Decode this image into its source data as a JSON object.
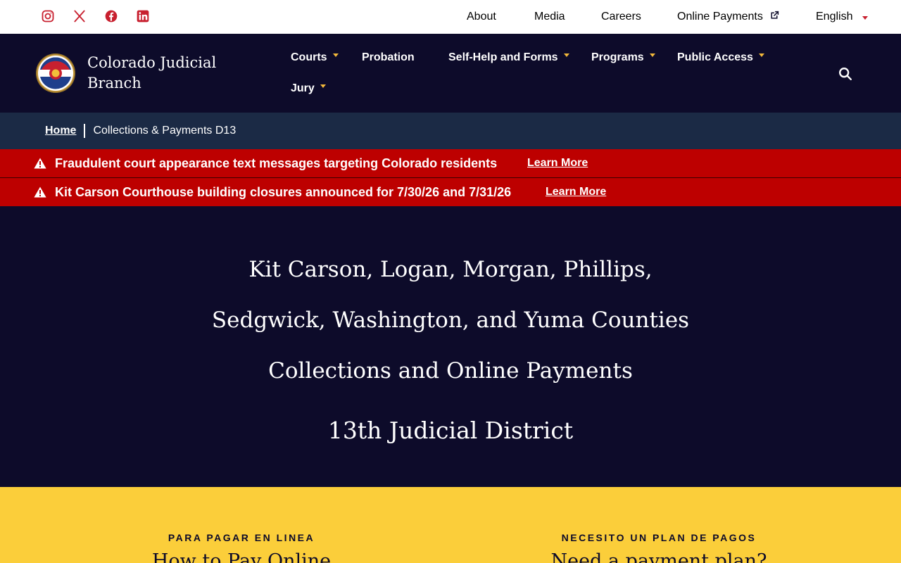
{
  "utility": {
    "social": [
      "instagram-icon",
      "x-icon",
      "facebook-icon",
      "linkedin-icon"
    ],
    "links": {
      "about": "About",
      "media": "Media",
      "careers": "Careers",
      "online_payments": "Online Payments",
      "language": "English"
    }
  },
  "header": {
    "brand": "Colorado Judicial Branch",
    "nav": {
      "courts": "Courts",
      "probation": "Probation",
      "self_help": "Self-Help and Forms",
      "programs": "Programs",
      "public_access": "Public Access",
      "jury": "Jury"
    }
  },
  "breadcrumb": {
    "home": "Home",
    "current": "Collections & Payments D13"
  },
  "alerts": [
    {
      "text": "Fraudulent court appearance text messages targeting Colorado residents",
      "link": "Learn More"
    },
    {
      "text": "Kit Carson Courthouse building closures announced for 7/30/26 and 7/31/26",
      "link": "Learn More"
    }
  ],
  "hero": {
    "line1": "Kit Carson, Logan, Morgan, Phillips,",
    "line2": "Sedgwick, Washington, and Yuma Counties",
    "line3": "Collections and Online Payments",
    "line4": "13th Judicial District"
  },
  "payments": {
    "col1": {
      "kicker": "PARA PAGAR EN LINEA",
      "title": "How to Pay Online"
    },
    "col2": {
      "kicker": "NECESITO UN PLAN DE PAGOS",
      "title": "Need a payment plan?"
    }
  },
  "colors": {
    "navy": "#0d0b2a",
    "breadcrumb_bg": "#1b2a45",
    "alert_red": "#bd0000",
    "accent_red": "#c8202f",
    "gold": "#f2b83a",
    "yellow": "#fbce3a"
  }
}
